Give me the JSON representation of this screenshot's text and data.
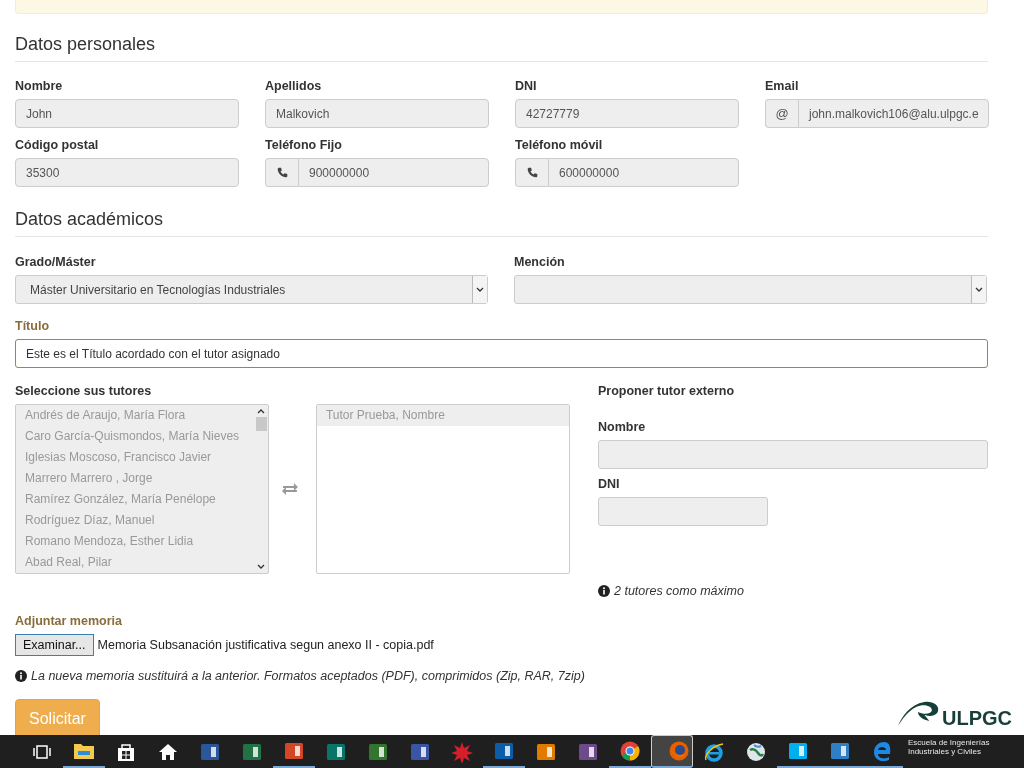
{
  "alert": {
    "kind": "warning"
  },
  "personal": {
    "heading": "Datos personales",
    "fields": [
      {
        "label": "Nombre",
        "value": "John",
        "kind": "plain"
      },
      {
        "label": "Apellidos",
        "value": "Malkovich",
        "kind": "plain"
      },
      {
        "label": "DNI",
        "value": "42727779",
        "kind": "plain"
      },
      {
        "label": "Email",
        "value": "john.malkovich106@alu.ulpgc.e",
        "kind": "text-addon",
        "addon_text": "@"
      },
      {
        "label": "Código postal",
        "value": "35300",
        "kind": "plain"
      },
      {
        "label": "Teléfono Fijo",
        "value": "900000000",
        "kind": "phone"
      },
      {
        "label": "Teléfono móvil",
        "value": "600000000",
        "kind": "phone"
      }
    ]
  },
  "academic": {
    "heading": "Datos académicos",
    "selects": [
      {
        "label": "Grado/Máster",
        "value": "Máster Universitario en Tecnologías Industriales"
      },
      {
        "label": "Mención"
      }
    ],
    "title_field": {
      "label": "Título",
      "value": "Este es el Título acordado con el tutor asignado",
      "warning": true
    }
  },
  "tutors": {
    "label": "Seleccione sus tutores",
    "available": [
      {
        "name": "Andrés de Araujo, María Flora",
        "selected": false
      },
      {
        "name": "Caro García-Quismondos, María Nieves",
        "selected": false
      },
      {
        "name": "Iglesias Moscoso, Francisco Javier",
        "selected": false
      },
      {
        "name": "Marrero Marrero , Jorge",
        "selected": false
      },
      {
        "name": "Ramírez González, María Penélope",
        "selected": false
      },
      {
        "name": "Rodríguez Díaz, Manuel",
        "selected": false
      },
      {
        "name": "Romano Mendoza, Esther Lidia",
        "selected": false
      },
      {
        "name": "Abad Real, Pilar",
        "selected": false
      }
    ],
    "chosen": [
      {
        "name": "Tutor Prueba, Nombre",
        "selected": true
      }
    ]
  },
  "external": {
    "heading": "Proponer tutor externo",
    "name_label": "Nombre",
    "dni_label": "DNI",
    "note": "2 tutores como máximo"
  },
  "attachment": {
    "label": "Adjuntar memoria",
    "button": "Examinar...",
    "file": "Memoria Subsanación justificativa segun anexo II - copia.pdf",
    "note": "La nueva memoria sustituirá a la anterior. Formatos aceptados (PDF), comprimidos (Zip, RAR, 7zip)"
  },
  "submit": "Solicitar",
  "logo": {
    "name": "ULPGC",
    "subtitle": "Escuela de Ingenierías Industriales y Civiles"
  },
  "taskbar": [
    {
      "kind": "task-view",
      "running": false,
      "selected": false
    },
    {
      "kind": "explorer",
      "running": true,
      "selected": false
    },
    {
      "kind": "store",
      "running": false,
      "selected": false
    },
    {
      "kind": "home",
      "running": false,
      "selected": false
    },
    {
      "kind": "word",
      "running": false,
      "selected": false
    },
    {
      "kind": "excel",
      "running": false,
      "selected": false
    },
    {
      "kind": "powerpoint",
      "running": true,
      "selected": false
    },
    {
      "kind": "publisher",
      "running": false,
      "selected": false
    },
    {
      "kind": "project",
      "running": false,
      "selected": false
    },
    {
      "kind": "visio",
      "running": false,
      "selected": false
    },
    {
      "kind": "star",
      "running": false,
      "selected": false
    },
    {
      "kind": "photoshop",
      "running": true,
      "selected": false
    },
    {
      "kind": "illustrator",
      "running": false,
      "selected": false
    },
    {
      "kind": "premiere",
      "running": false,
      "selected": false
    },
    {
      "kind": "chrome",
      "running": true,
      "selected": false
    },
    {
      "kind": "firefox",
      "running": true,
      "selected": true
    },
    {
      "kind": "ie",
      "running": false,
      "selected": false
    },
    {
      "kind": "globe",
      "running": false,
      "selected": false
    },
    {
      "kind": "skype",
      "running": true,
      "selected": false
    },
    {
      "kind": "media",
      "running": true,
      "selected": false
    },
    {
      "kind": "edge",
      "running": true,
      "selected": false
    }
  ]
}
